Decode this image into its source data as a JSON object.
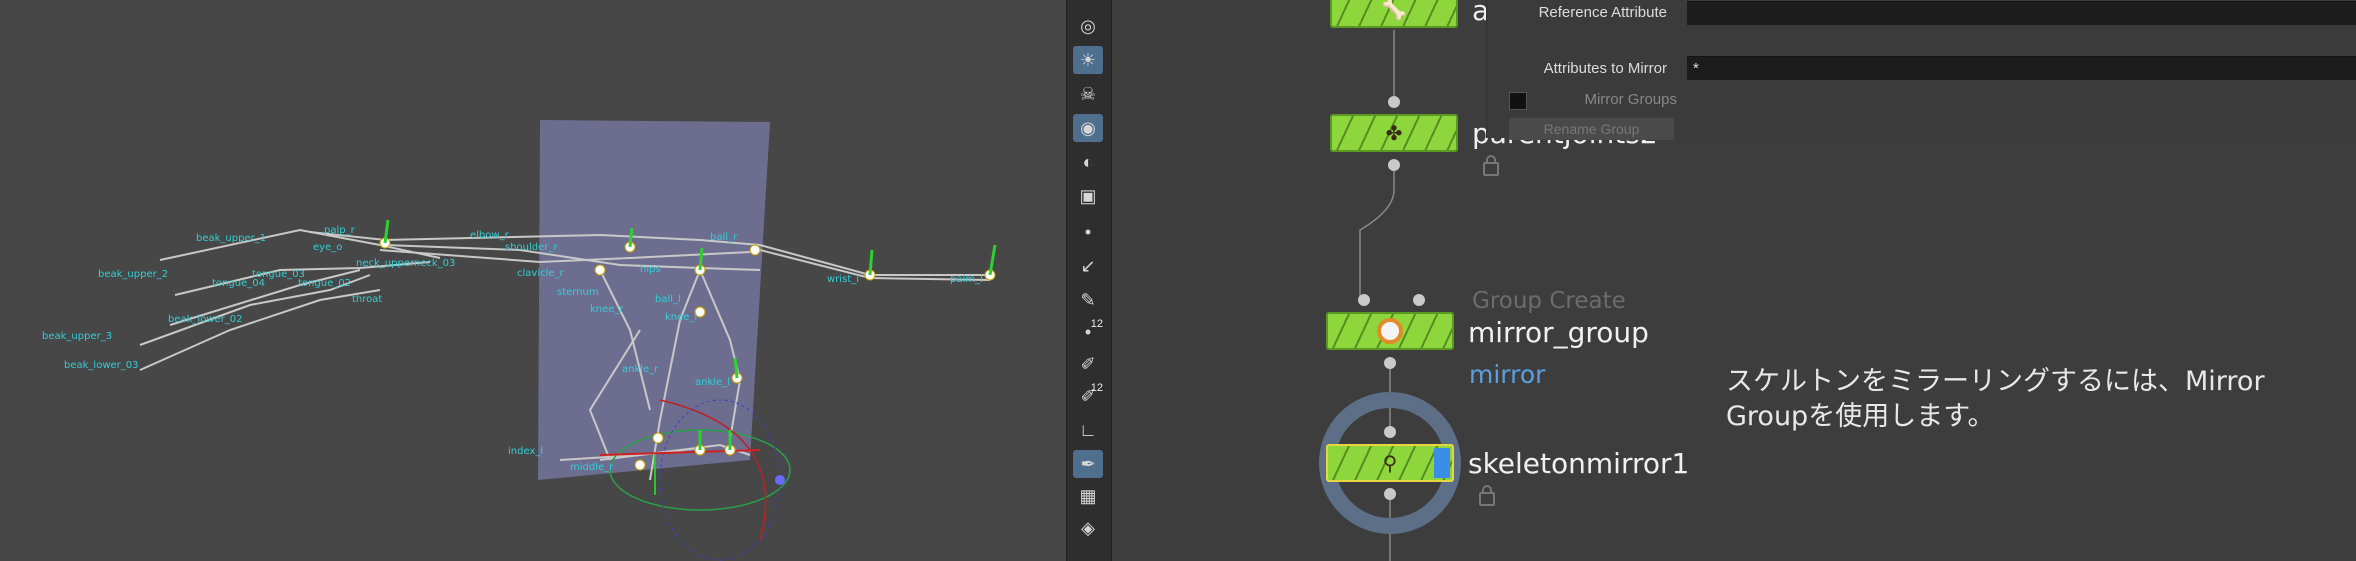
{
  "viewport": {
    "joint_labels": [
      {
        "text": "beak_upper_1"
      },
      {
        "text": "beak_upper_2"
      },
      {
        "text": "beak_upper_3"
      },
      {
        "text": "beak_lower_02"
      },
      {
        "text": "beak_lower_03"
      },
      {
        "text": "tongue_04"
      },
      {
        "text": "tongue_03"
      },
      {
        "text": "tongue_02"
      },
      {
        "text": "eye_o"
      },
      {
        "text": "palp_r"
      },
      {
        "text": "neck_upperneck_03"
      },
      {
        "text": "throat"
      },
      {
        "text": "elbow_r"
      },
      {
        "text": "shoulder_r"
      },
      {
        "text": "clavicle_r"
      },
      {
        "text": "sternum"
      },
      {
        "text": "knee_r"
      },
      {
        "text": "knee_l"
      },
      {
        "text": "ankle_r"
      },
      {
        "text": "ankle_l"
      },
      {
        "text": "ball_l"
      },
      {
        "text": "ball_r"
      },
      {
        "text": "wrist_l"
      },
      {
        "text": "palm_l"
      },
      {
        "text": "hips"
      },
      {
        "text": "index_l"
      },
      {
        "text": "middle_r"
      }
    ]
  },
  "toolbar": {
    "tools": [
      {
        "icon": "sphere-icon"
      },
      {
        "icon": "light-icon"
      },
      {
        "icon": "skeleton-icon"
      },
      {
        "icon": "camera-icon"
      },
      {
        "icon": "eye-icon"
      },
      {
        "icon": "snapshot-icon"
      },
      {
        "icon": "point-icon"
      },
      {
        "icon": "edge-icon"
      },
      {
        "icon": "pick-icon"
      },
      {
        "icon": "number-icon",
        "badge": "12"
      },
      {
        "icon": "brush-icon"
      },
      {
        "icon": "number-icon-2",
        "badge": "12"
      },
      {
        "icon": "angle-icon"
      },
      {
        "icon": "sculpt-icon"
      },
      {
        "icon": "checker-icon"
      },
      {
        "icon": "layers-icon"
      }
    ]
  },
  "network": {
    "nodes": [
      {
        "name": "a",
        "type": ""
      },
      {
        "name": "parentjoints2",
        "type": ""
      },
      {
        "name": "mirror_group",
        "type": "Group Create",
        "group_tag": "mirror"
      },
      {
        "name": "skeletonmirror1",
        "type": ""
      }
    ]
  },
  "params": {
    "reference_attribute_label": "Reference Attribute",
    "reference_attribute_value": "",
    "attributes_to_mirror_label": "Attributes to Mirror",
    "attributes_to_mirror_value": "*",
    "mirror_groups_label": "Mirror Groups",
    "rename_group_label": "Rename Group"
  },
  "caption": "スケルトンをミラーリングするには、Mirror Groupを使用します。",
  "colors": {
    "node_green": "#8dd63c",
    "selected_outline": "#e6d640",
    "group_blue": "#5aa0e0",
    "joint_label": "#2fd0d6"
  }
}
